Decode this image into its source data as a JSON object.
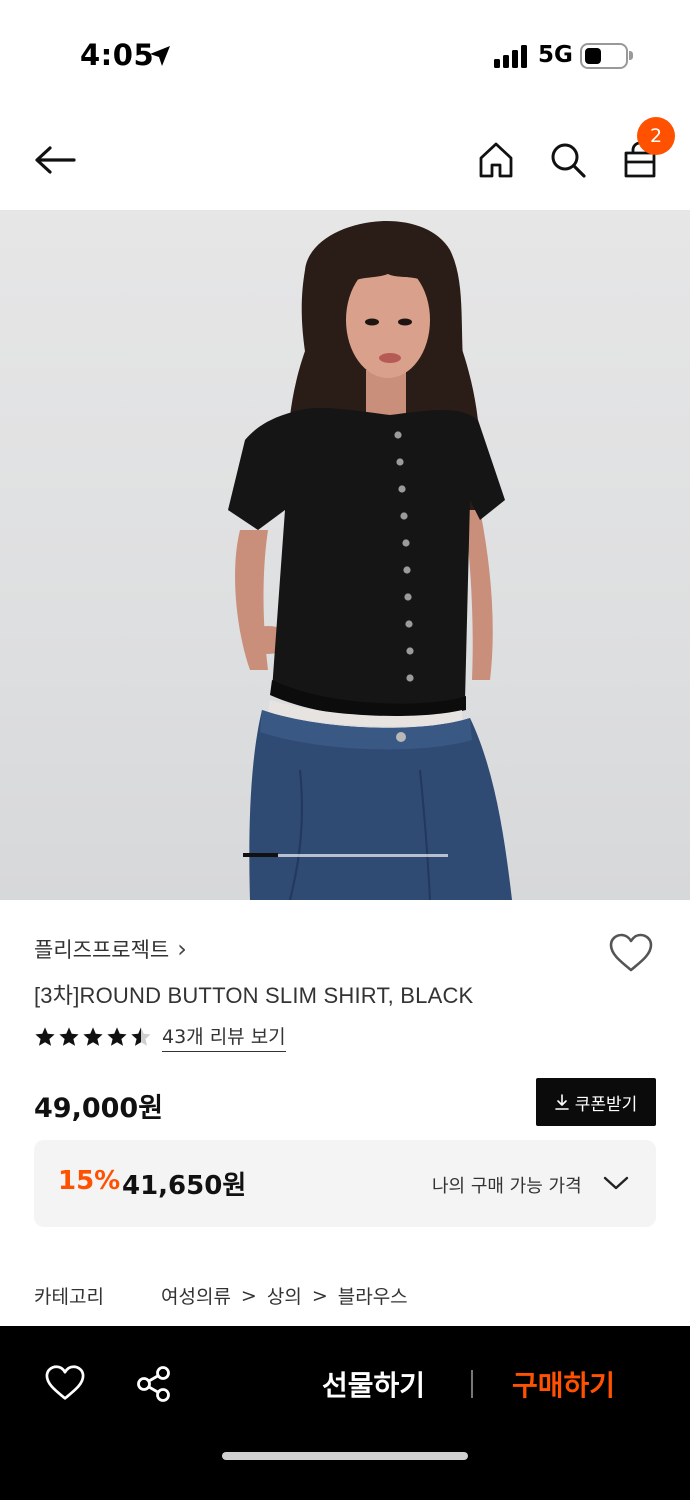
{
  "status_bar": {
    "time": "4:05",
    "network": "5G"
  },
  "header": {
    "cart_count": "2"
  },
  "carousel": {
    "current_index": 1,
    "progress": 0.17
  },
  "product": {
    "brand": "플리즈프로젝트",
    "brand_chevron": "›",
    "name": "[3차]ROUND BUTTON SLIM SHIRT, BLACK",
    "rating": 4.5,
    "review_link": "43개 리뷰 보기",
    "price": "49,000원",
    "coupon_label": "쿠폰받기"
  },
  "discount": {
    "percent": "15%",
    "price": "41,650원",
    "label": "나의 구매 가능 가격"
  },
  "category": {
    "label": "카테고리",
    "path": [
      "여성의류",
      "상의",
      "블라우스"
    ],
    "separator": ">"
  },
  "bottom_bar": {
    "gift_label": "선물하기",
    "buy_label": "구매하기"
  },
  "colors": {
    "accent": "#ff5100",
    "dark": "#0b0b0b",
    "panel": "#f4f4f5"
  }
}
